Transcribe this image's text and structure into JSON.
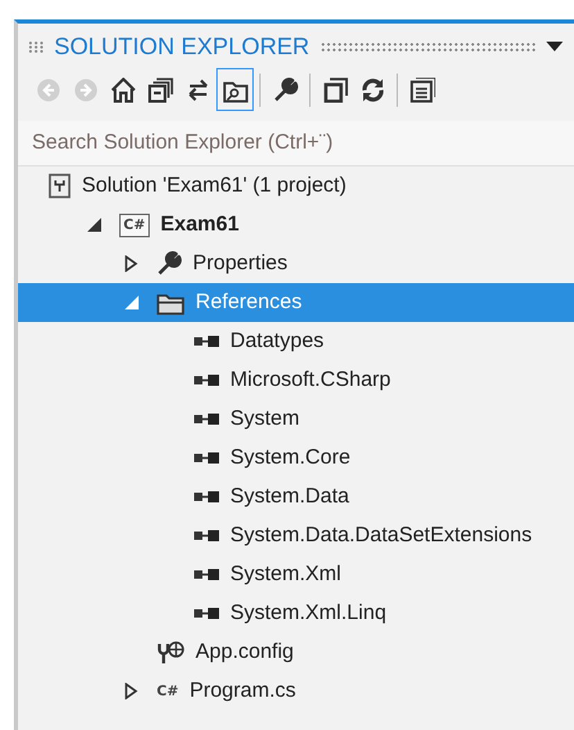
{
  "panel": {
    "title": "SOLUTION EXPLORER"
  },
  "toolbar": [
    {
      "kind": "back",
      "disabled": true,
      "selected": false
    },
    {
      "kind": "forward",
      "disabled": true,
      "selected": false
    },
    {
      "kind": "home",
      "disabled": false,
      "selected": false
    },
    {
      "kind": "collapse",
      "disabled": false,
      "selected": false
    },
    {
      "kind": "sync",
      "disabled": false,
      "selected": false
    },
    {
      "kind": "preview",
      "disabled": false,
      "selected": true
    },
    {
      "kind": "separator"
    },
    {
      "kind": "wrench",
      "disabled": false,
      "selected": false
    },
    {
      "kind": "separator"
    },
    {
      "kind": "windows",
      "disabled": false,
      "selected": false
    },
    {
      "kind": "refresh",
      "disabled": false,
      "selected": false
    },
    {
      "kind": "separator"
    },
    {
      "kind": "properties",
      "disabled": false,
      "selected": false
    }
  ],
  "search": {
    "placeholder": "Search Solution Explorer (Ctrl+¨)"
  },
  "tree": [
    {
      "kind": "solution",
      "label": "Solution 'Exam61' (1 project)",
      "selected": false,
      "children": [
        {
          "kind": "project",
          "badge": "C#",
          "label": "Exam61",
          "bold": true,
          "expanded": true,
          "selected": false,
          "children": [
            {
              "kind": "wrench",
              "label": "Properties",
              "expanded": false,
              "selected": false
            },
            {
              "kind": "folder",
              "label": "References",
              "expanded": true,
              "selected": true,
              "children": [
                {
                  "kind": "reference",
                  "label": "Datatypes",
                  "selected": false
                },
                {
                  "kind": "reference",
                  "label": "Microsoft.CSharp",
                  "selected": false
                },
                {
                  "kind": "reference",
                  "label": "System",
                  "selected": false
                },
                {
                  "kind": "reference",
                  "label": "System.Core",
                  "selected": false
                },
                {
                  "kind": "reference",
                  "label": "System.Data",
                  "selected": false
                },
                {
                  "kind": "reference",
                  "label": "System.Data.DataSetExtensions",
                  "selected": false
                },
                {
                  "kind": "reference",
                  "label": "System.Xml",
                  "selected": false
                },
                {
                  "kind": "reference",
                  "label": "System.Xml.Linq",
                  "selected": false
                }
              ]
            },
            {
              "kind": "config",
              "label": "App.config",
              "selected": false
            },
            {
              "kind": "csfile",
              "badge": "C#",
              "label": "Program.cs",
              "expanded": false,
              "selected": false
            }
          ]
        }
      ]
    }
  ]
}
